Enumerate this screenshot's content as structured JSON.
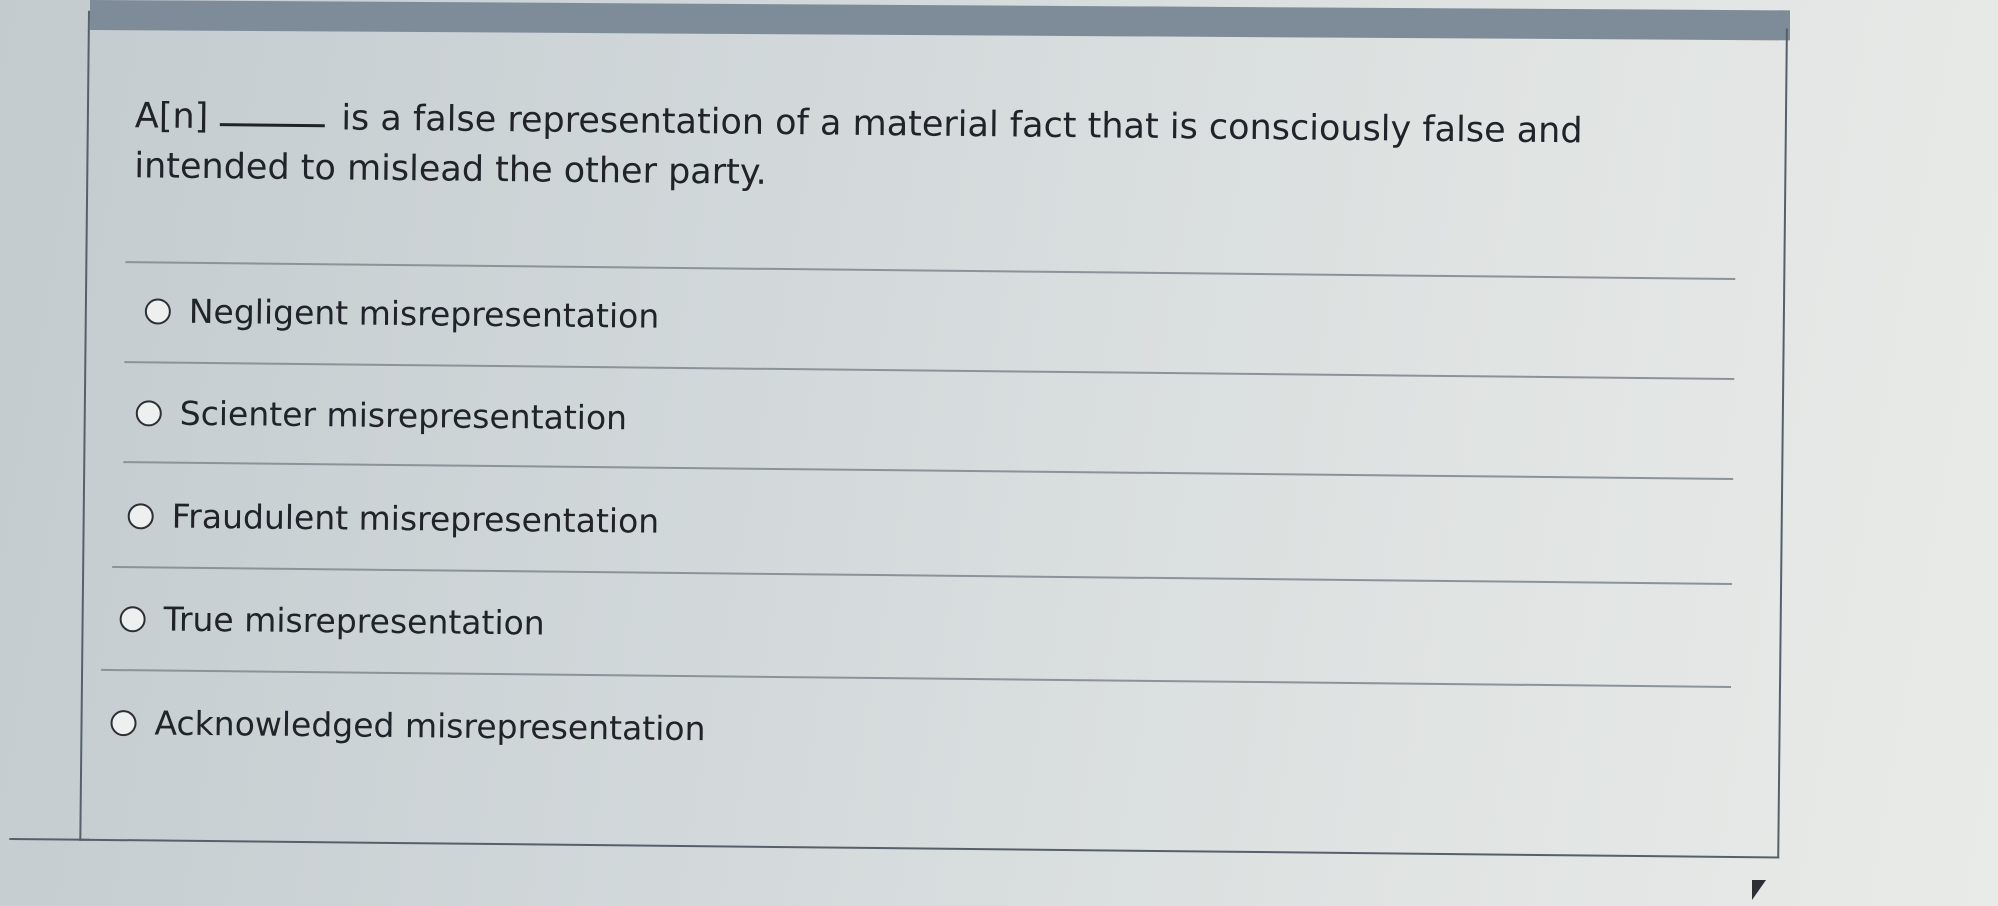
{
  "question": {
    "prefix": "A[n]",
    "suffix": "is a false representation of a material fact that is consciously false and intended to mislead the other party."
  },
  "options": [
    {
      "label": "Negligent misrepresentation",
      "icon": "radio-unselected-icon"
    },
    {
      "label": "Scienter misrepresentation",
      "icon": "radio-unselected-icon"
    },
    {
      "label": "Fraudulent misrepresentation",
      "icon": "radio-unselected-icon"
    },
    {
      "label": "True misrepresentation",
      "icon": "radio-unselected-icon"
    },
    {
      "label": "Acknowledged misrepresentation",
      "icon": "radio-unselected-icon"
    }
  ]
}
